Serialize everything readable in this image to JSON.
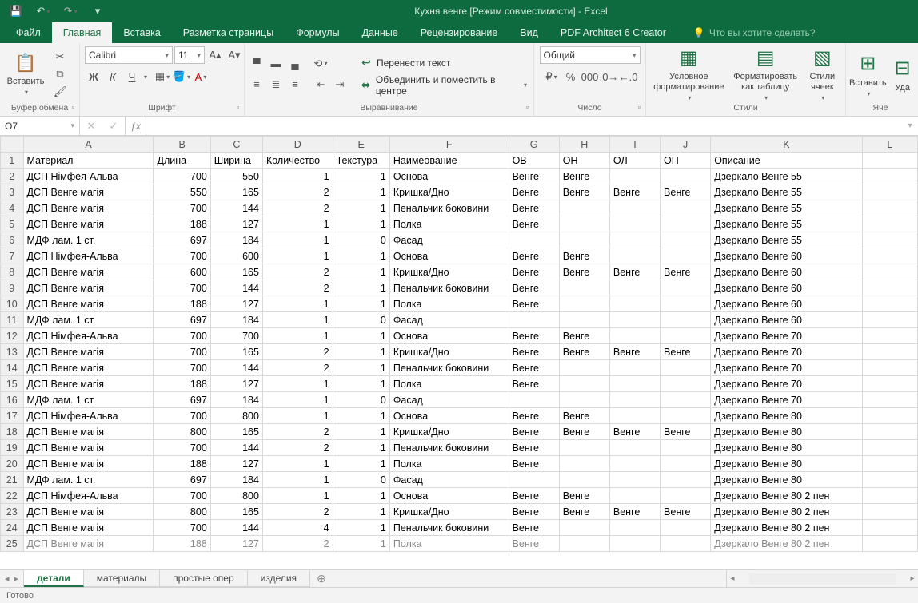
{
  "app": {
    "title": "Кухня венге  [Режим совместимости] - Excel"
  },
  "qat": {
    "save": "💾",
    "undo": "↶",
    "redo": "↷",
    "more": "▾"
  },
  "tabs": {
    "file": "Файл",
    "home": "Главная",
    "insert": "Вставка",
    "layout": "Разметка страницы",
    "formulas": "Формулы",
    "data": "Данные",
    "review": "Рецензирование",
    "view": "Вид",
    "pdf": "PDF Architect 6 Creator",
    "tell_me": "Что вы хотите сделать?"
  },
  "ribbon": {
    "clipboard": {
      "paste": "Вставить",
      "label": "Буфер обмена"
    },
    "font": {
      "name": "Calibri",
      "size": "11",
      "label": "Шрифт",
      "bold": "Ж",
      "italic": "К",
      "underline": "Ч"
    },
    "alignment": {
      "wrap": "Перенести текст",
      "merge": "Объединить и поместить в центре",
      "label": "Выравнивание"
    },
    "number": {
      "format": "Общий",
      "label": "Число"
    },
    "styles": {
      "cond": "Условное форматирование",
      "table": "Форматировать как таблицу",
      "cell": "Стили ячеек",
      "label": "Стили"
    },
    "cells": {
      "insert": "Вставить",
      "delete": "Уда",
      "label": "Яче"
    }
  },
  "name_box": "O7",
  "columns": [
    "A",
    "B",
    "C",
    "D",
    "E",
    "F",
    "G",
    "H",
    "I",
    "J",
    "K",
    "L"
  ],
  "headers": {
    "A": "Материал",
    "B": "Длина",
    "C": "Ширина",
    "D": "Количество",
    "E": "Текстура",
    "F": "Наимеование",
    "G": "ОВ",
    "H": "ОН",
    "I": "ОЛ",
    "J": "ОП",
    "K": "Описание"
  },
  "rows": [
    {
      "n": 2,
      "A": "ДСП Німфея-Альва",
      "B": "700",
      "C": "550",
      "D": "1",
      "E": "1",
      "F": "Основа",
      "G": "Венге",
      "H": "Венге",
      "I": "",
      "J": "",
      "K": "Дзеркало Венге 55"
    },
    {
      "n": 3,
      "A": "ДСП Венге магія",
      "B": "550",
      "C": "165",
      "D": "2",
      "E": "1",
      "F": "Кришка/Дно",
      "G": "Венге",
      "H": "Венге",
      "I": "Венге",
      "J": "Венге",
      "K": "Дзеркало Венге 55"
    },
    {
      "n": 4,
      "A": "ДСП Венге магія",
      "B": "700",
      "C": "144",
      "D": "2",
      "E": "1",
      "F": "Пенальчик боковини",
      "G": "Венге",
      "H": "",
      "I": "",
      "J": "",
      "K": "Дзеркало Венге 55"
    },
    {
      "n": 5,
      "A": "ДСП Венге магія",
      "B": "188",
      "C": "127",
      "D": "1",
      "E": "1",
      "F": "Полка",
      "G": "Венге",
      "H": "",
      "I": "",
      "J": "",
      "K": "Дзеркало Венге 55"
    },
    {
      "n": 6,
      "A": "МДФ лам. 1 ст.",
      "B": "697",
      "C": "184",
      "D": "1",
      "E": "0",
      "F": "Фасад",
      "G": "",
      "H": "",
      "I": "",
      "J": "",
      "K": "Дзеркало Венге 55"
    },
    {
      "n": 7,
      "A": "ДСП Німфея-Альва",
      "B": "700",
      "C": "600",
      "D": "1",
      "E": "1",
      "F": "Основа",
      "G": "Венге",
      "H": "Венге",
      "I": "",
      "J": "",
      "K": "Дзеркало Венге 60"
    },
    {
      "n": 8,
      "A": "ДСП Венге магія",
      "B": "600",
      "C": "165",
      "D": "2",
      "E": "1",
      "F": "Кришка/Дно",
      "G": "Венге",
      "H": "Венге",
      "I": "Венге",
      "J": "Венге",
      "K": "Дзеркало Венге 60"
    },
    {
      "n": 9,
      "A": "ДСП Венге магія",
      "B": "700",
      "C": "144",
      "D": "2",
      "E": "1",
      "F": "Пенальчик боковини",
      "G": "Венге",
      "H": "",
      "I": "",
      "J": "",
      "K": "Дзеркало Венге 60"
    },
    {
      "n": 10,
      "A": "ДСП Венге магія",
      "B": "188",
      "C": "127",
      "D": "1",
      "E": "1",
      "F": "Полка",
      "G": "Венге",
      "H": "",
      "I": "",
      "J": "",
      "K": "Дзеркало Венге 60"
    },
    {
      "n": 11,
      "A": "МДФ лам. 1 ст.",
      "B": "697",
      "C": "184",
      "D": "1",
      "E": "0",
      "F": "Фасад",
      "G": "",
      "H": "",
      "I": "",
      "J": "",
      "K": "Дзеркало Венге 60"
    },
    {
      "n": 12,
      "A": "ДСП Німфея-Альва",
      "B": "700",
      "C": "700",
      "D": "1",
      "E": "1",
      "F": "Основа",
      "G": "Венге",
      "H": "Венге",
      "I": "",
      "J": "",
      "K": "Дзеркало Венге 70"
    },
    {
      "n": 13,
      "A": "ДСП Венге магія",
      "B": "700",
      "C": "165",
      "D": "2",
      "E": "1",
      "F": "Кришка/Дно",
      "G": "Венге",
      "H": "Венге",
      "I": "Венге",
      "J": "Венге",
      "K": "Дзеркало Венге 70"
    },
    {
      "n": 14,
      "A": "ДСП Венге магія",
      "B": "700",
      "C": "144",
      "D": "2",
      "E": "1",
      "F": "Пенальчик боковини",
      "G": "Венге",
      "H": "",
      "I": "",
      "J": "",
      "K": "Дзеркало Венге 70"
    },
    {
      "n": 15,
      "A": "ДСП Венге магія",
      "B": "188",
      "C": "127",
      "D": "1",
      "E": "1",
      "F": "Полка",
      "G": "Венге",
      "H": "",
      "I": "",
      "J": "",
      "K": "Дзеркало Венге 70"
    },
    {
      "n": 16,
      "A": "МДФ лам. 1 ст.",
      "B": "697",
      "C": "184",
      "D": "1",
      "E": "0",
      "F": "Фасад",
      "G": "",
      "H": "",
      "I": "",
      "J": "",
      "K": "Дзеркало Венге 70"
    },
    {
      "n": 17,
      "A": "ДСП Німфея-Альва",
      "B": "700",
      "C": "800",
      "D": "1",
      "E": "1",
      "F": "Основа",
      "G": "Венге",
      "H": "Венге",
      "I": "",
      "J": "",
      "K": "Дзеркало Венге 80"
    },
    {
      "n": 18,
      "A": "ДСП Венге магія",
      "B": "800",
      "C": "165",
      "D": "2",
      "E": "1",
      "F": "Кришка/Дно",
      "G": "Венге",
      "H": "Венге",
      "I": "Венге",
      "J": "Венге",
      "K": "Дзеркало Венге 80"
    },
    {
      "n": 19,
      "A": "ДСП Венге магія",
      "B": "700",
      "C": "144",
      "D": "2",
      "E": "1",
      "F": "Пенальчик боковини",
      "G": "Венге",
      "H": "",
      "I": "",
      "J": "",
      "K": "Дзеркало Венге 80"
    },
    {
      "n": 20,
      "A": "ДСП Венге магія",
      "B": "188",
      "C": "127",
      "D": "1",
      "E": "1",
      "F": "Полка",
      "G": "Венге",
      "H": "",
      "I": "",
      "J": "",
      "K": "Дзеркало Венге 80"
    },
    {
      "n": 21,
      "A": "МДФ лам. 1 ст.",
      "B": "697",
      "C": "184",
      "D": "1",
      "E": "0",
      "F": "Фасад",
      "G": "",
      "H": "",
      "I": "",
      "J": "",
      "K": "Дзеркало Венге 80"
    },
    {
      "n": 22,
      "A": "ДСП Німфея-Альва",
      "B": "700",
      "C": "800",
      "D": "1",
      "E": "1",
      "F": "Основа",
      "G": "Венге",
      "H": "Венге",
      "I": "",
      "J": "",
      "K": "Дзеркало Венге 80 2 пен"
    },
    {
      "n": 23,
      "A": "ДСП Венге магія",
      "B": "800",
      "C": "165",
      "D": "2",
      "E": "1",
      "F": "Кришка/Дно",
      "G": "Венге",
      "H": "Венге",
      "I": "Венге",
      "J": "Венге",
      "K": "Дзеркало Венге 80 2 пен"
    },
    {
      "n": 24,
      "A": "ДСП Венге магія",
      "B": "700",
      "C": "144",
      "D": "4",
      "E": "1",
      "F": "Пенальчик боковини",
      "G": "Венге",
      "H": "",
      "I": "",
      "J": "",
      "K": "Дзеркало Венге 80 2 пен"
    },
    {
      "n": 25,
      "A": "ДСП Венге магія",
      "B": "188",
      "C": "127",
      "D": "2",
      "E": "1",
      "F": "Полка",
      "G": "Венге",
      "H": "",
      "I": "",
      "J": "",
      "K": "Дзеркало Венге 80 2 пен"
    }
  ],
  "sheet_tabs": {
    "active": "детали",
    "t2": "материалы",
    "t3": "простые опер",
    "t4": "изделия"
  },
  "status": "Готово"
}
